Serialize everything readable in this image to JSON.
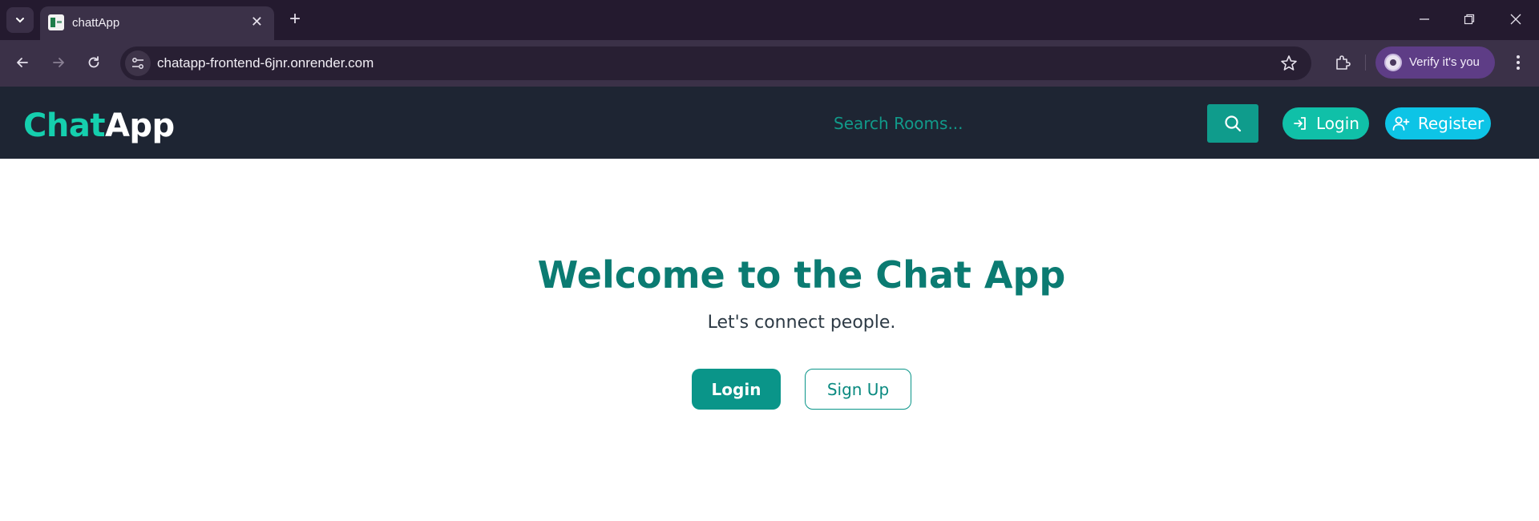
{
  "browser": {
    "tab": {
      "title": "chattApp",
      "favicon": "sheet-favicon-icon"
    },
    "address_bar": {
      "url": "chatapp-frontend-6jnr.onrender.com"
    },
    "profile": {
      "label": "Verify it's you"
    },
    "window_controls": [
      "minimize-icon",
      "restore-icon",
      "close-icon"
    ]
  },
  "navbar": {
    "brand_part1": "Chat",
    "brand_part2": "App",
    "search": {
      "placeholder": "Search Rooms..."
    },
    "login_label": "Login",
    "register_label": "Register"
  },
  "hero": {
    "title": "Welcome to the Chat App",
    "subtitle": "Let's connect people.",
    "login_label": "Login",
    "signup_label": "Sign Up"
  },
  "colors": {
    "accent": "#15cfae",
    "primary": "#0a9589",
    "register": "#0dc4e6",
    "navbar_bg": "#1e2533",
    "heading": "#0b7b72"
  }
}
